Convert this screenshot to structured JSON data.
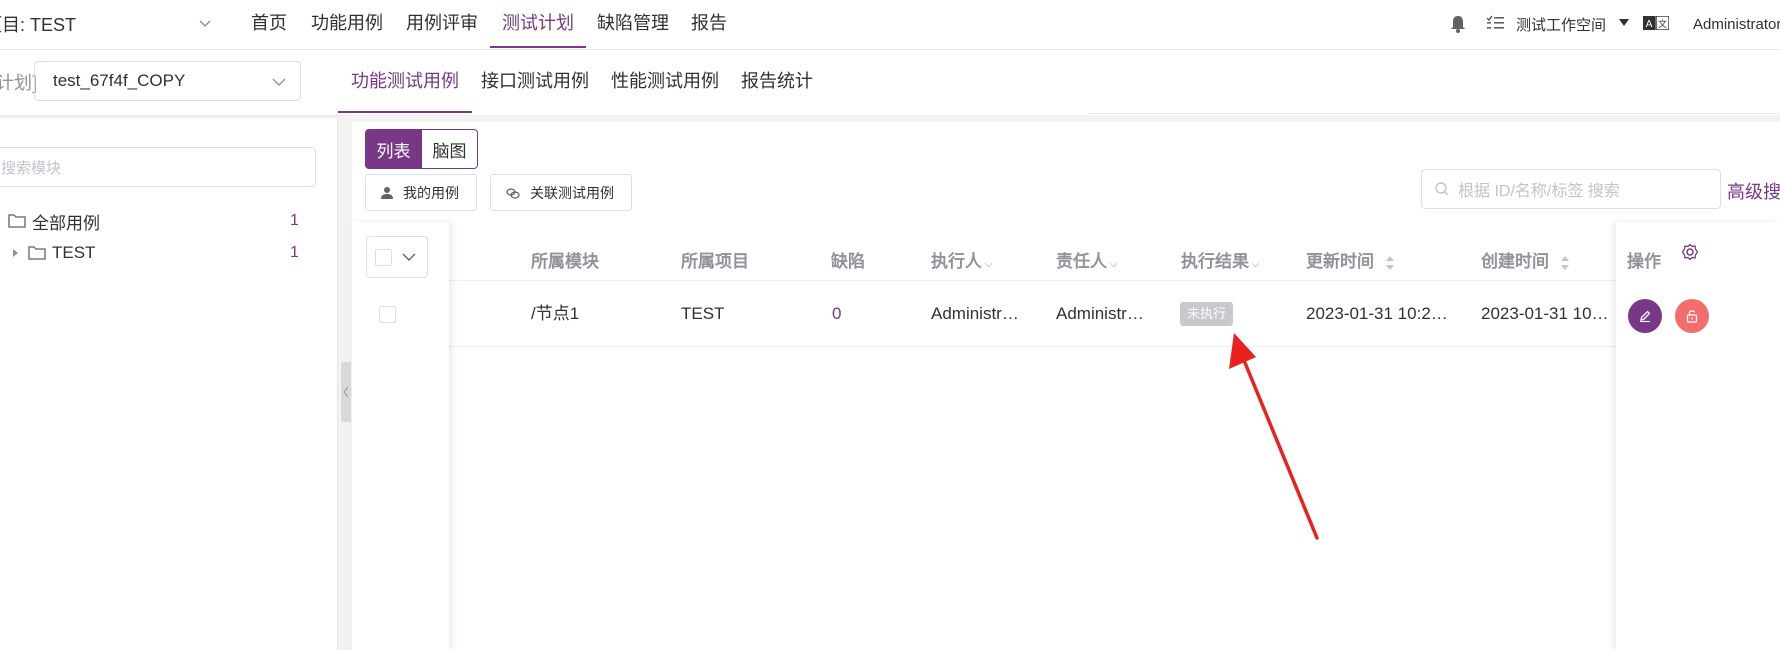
{
  "header": {
    "project_label": "项目: TEST",
    "menu": [
      "首页",
      "功能用例",
      "用例评审",
      "测试计划",
      "缺陷管理",
      "报告"
    ],
    "active_menu": "测试计划",
    "workspace": "测试工作空间",
    "user": "Administrator"
  },
  "subheader": {
    "plan_label": "计划]",
    "plan_value": "test_67f4f_COPY",
    "tabs": [
      "功能测试用例",
      "接口测试用例",
      "性能测试用例",
      "报告统计"
    ],
    "active_tab": "功能测试用例"
  },
  "sidebar": {
    "search_placeholder": "搜索模块",
    "tree": [
      {
        "label": "全部用例",
        "count": "1"
      },
      {
        "label": "TEST",
        "count": "1"
      }
    ]
  },
  "toolbar": {
    "view_list": "列表",
    "view_mind": "脑图",
    "my_cases": "我的用例",
    "link_cases": "关联测试用例",
    "search_placeholder": "根据 ID/名称/标签 搜索",
    "advanced_search": "高级搜"
  },
  "table": {
    "columns": [
      "所属模块",
      "所属项目",
      "缺陷",
      "执行人",
      "责任人",
      "执行结果",
      "更新时间",
      "创建时间",
      "操作"
    ],
    "rows": [
      {
        "module": "/节点1",
        "project": "TEST",
        "defects": "0",
        "executor": "Administr…",
        "owner": "Administr…",
        "result": "未执行",
        "updated": "2023-01-31 10:2…",
        "created": "2023-01-31 10:2…"
      }
    ]
  },
  "colors": {
    "accent": "#783887",
    "danger": "#f56c6c",
    "annotation_arrow": "#e8221f"
  }
}
